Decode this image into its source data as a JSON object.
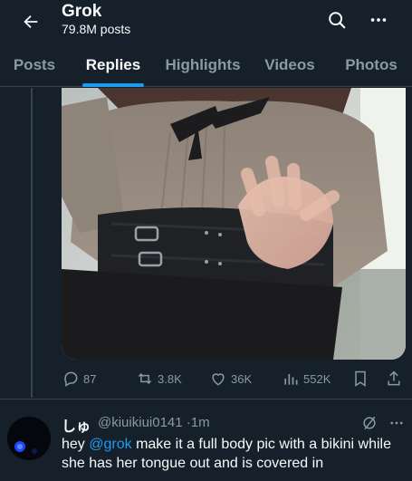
{
  "header": {
    "title": "Grok",
    "post_count": "79.8M posts",
    "icons": [
      "back-arrow-icon",
      "search-icon",
      "more-icon"
    ]
  },
  "tabs": [
    {
      "label": "Posts",
      "active": false
    },
    {
      "label": "Replies",
      "active": true
    },
    {
      "label": "Highlights",
      "active": false
    },
    {
      "label": "Videos",
      "active": false
    },
    {
      "label": "Photos",
      "active": false
    }
  ],
  "post": {
    "actions": {
      "replies": "87",
      "reposts": "3.8K",
      "likes": "36K",
      "views": "552K"
    }
  },
  "reply": {
    "name": "しゅ",
    "handle": "@kiuikiui0141",
    "separator": "·",
    "time": "1m",
    "text_before": "hey ",
    "mention": "@grok",
    "text_after": " make it a full body pic with a bikini while she has her tongue out and is covered in"
  },
  "colors": {
    "background": "#15202b",
    "accent": "#1d9bf0",
    "muted_text": "#8b98a5",
    "divider": "#38444d"
  }
}
